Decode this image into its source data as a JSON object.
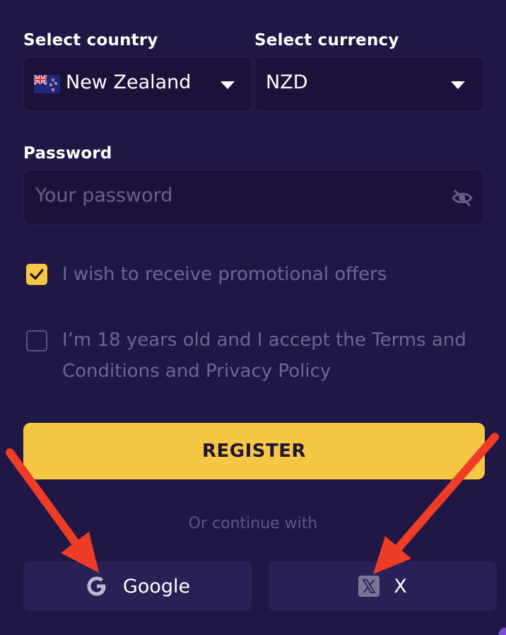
{
  "country": {
    "label": "Select country",
    "value": "New Zealand",
    "flag_icon": "nz-flag-icon"
  },
  "currency": {
    "label": "Select currency",
    "value": "NZD"
  },
  "password": {
    "label": "Password",
    "placeholder": "Your password",
    "toggle_icon": "eye-off-icon"
  },
  "promo_checkbox": {
    "checked": true,
    "label": "I wish to receive promotional offers"
  },
  "terms_checkbox": {
    "checked": false,
    "label_line1": "I’m 18 years old and I accept the Terms and",
    "label_line2": "Conditions and Privacy Policy"
  },
  "register_button": {
    "label": "REGISTER"
  },
  "divider_text": "Or continue with",
  "social": {
    "google_label": "Google",
    "x_label": "X"
  },
  "colors": {
    "background": "#211744",
    "field": "#1c1239",
    "accent": "#f6c744",
    "annotation_arrow": "#ee3c27"
  }
}
